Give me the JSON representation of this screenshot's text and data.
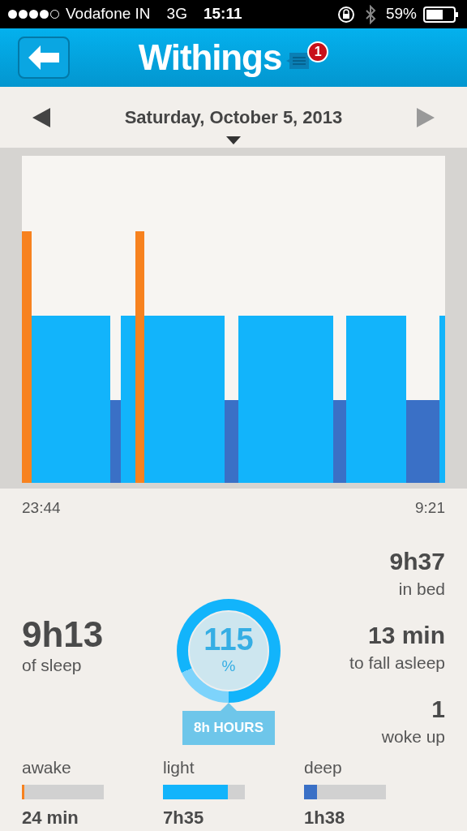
{
  "status_bar": {
    "carrier": "Vodafone IN",
    "network": "3G",
    "time": "15:11",
    "battery": "59%"
  },
  "header": {
    "title": "Withings",
    "badge": "1"
  },
  "date_nav": {
    "date": "Saturday, October 5, 2013",
    "next_disabled": true
  },
  "timeline": {
    "start": "23:44",
    "end": "9:21"
  },
  "summary": {
    "sleep_value": "9h13",
    "sleep_label": "of sleep",
    "percent": "115",
    "percent_sign": "%",
    "goal": "8h HOURS"
  },
  "stats": [
    {
      "value": "9h37",
      "label": "in bed"
    },
    {
      "value": "13 min",
      "label": "to fall asleep"
    },
    {
      "value": "1",
      "label": "woke up"
    }
  ],
  "breakdown": [
    {
      "label": "awake",
      "value": "24 min",
      "level": 0.03,
      "color": "#f7821f"
    },
    {
      "label": "light",
      "value": "7h35",
      "level": 0.79,
      "color": "#12b4fb"
    },
    {
      "label": "deep",
      "value": "1h38",
      "level": 0.16,
      "color": "#3a70c6"
    }
  ]
}
